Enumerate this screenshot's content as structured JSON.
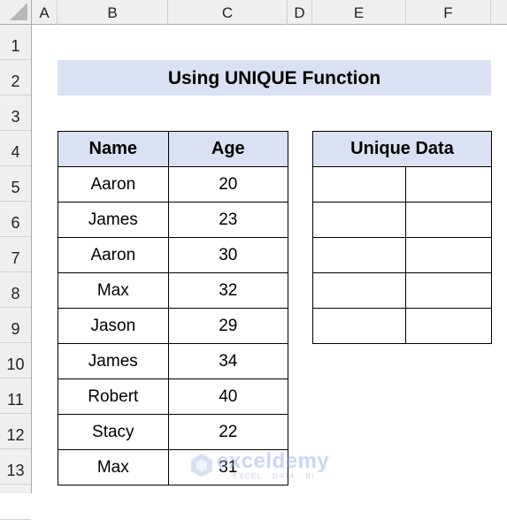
{
  "sheet": {
    "columns": [
      "A",
      "B",
      "C",
      "D",
      "E",
      "F"
    ],
    "rows": [
      "1",
      "2",
      "3",
      "4",
      "5",
      "6",
      "7",
      "8",
      "9",
      "10",
      "11",
      "12",
      "13"
    ]
  },
  "title": "Using UNIQUE Function",
  "source_table": {
    "headers": [
      "Name",
      "Age"
    ],
    "rows": [
      [
        "Aaron",
        "20"
      ],
      [
        "James",
        "23"
      ],
      [
        "Aaron",
        "30"
      ],
      [
        "Max",
        "32"
      ],
      [
        "Jason",
        "29"
      ],
      [
        "James",
        "34"
      ],
      [
        "Robert",
        "40"
      ],
      [
        "Stacy",
        "22"
      ],
      [
        "Max",
        "31"
      ]
    ]
  },
  "unique_table": {
    "header": "Unique Data",
    "rows": [
      [
        "",
        ""
      ],
      [
        "",
        ""
      ],
      [
        "",
        ""
      ],
      [
        "",
        ""
      ],
      [
        "",
        ""
      ]
    ]
  },
  "watermark": {
    "brand": "exceldemy",
    "tagline": "EXCEL · DATA · BI"
  },
  "colors": {
    "header_fill": "#D9E1F2",
    "watermark": "#8AA6E6"
  }
}
